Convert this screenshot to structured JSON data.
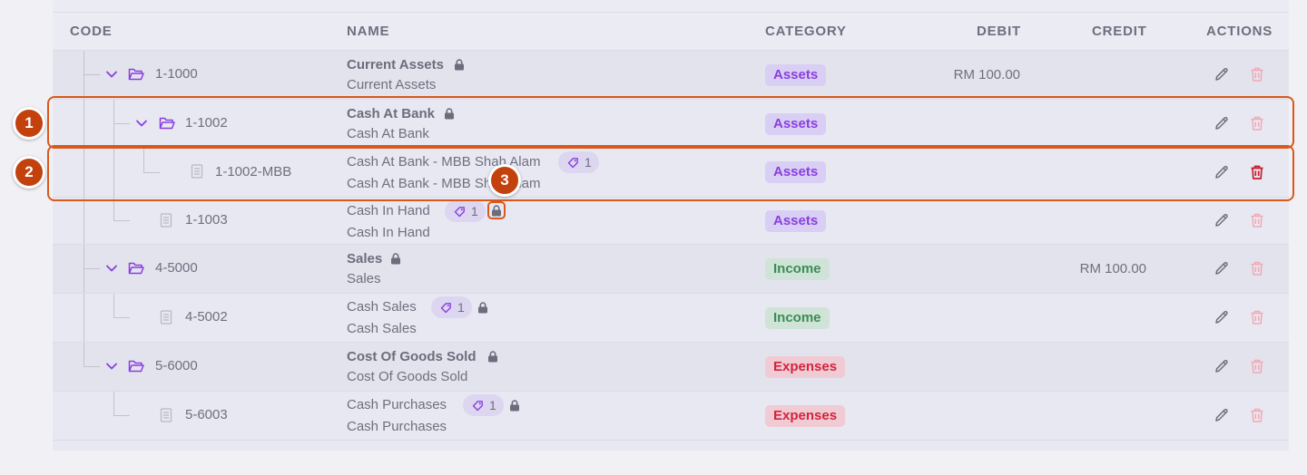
{
  "colors": {
    "accent_purple": "#8a3fe0",
    "income_green": "#3d8c56",
    "expense_red": "#d2243e",
    "highlight_orange": "#d9581a"
  },
  "header": {
    "code": "CODE",
    "name": "NAME",
    "category": "CATEGORY",
    "debit": "DEBIT",
    "credit": "CREDIT",
    "actions": "ACTIONS"
  },
  "rows": [
    {
      "code": "1-1000",
      "name": "Current Assets",
      "subname": "Current Assets",
      "category": "Assets",
      "debit": "RM 100.00",
      "credit": "",
      "locked": true,
      "tags": null,
      "type": "folder"
    },
    {
      "code": "1-1002",
      "name": "Cash At Bank",
      "subname": "Cash At Bank",
      "category": "Assets",
      "debit": "",
      "credit": "",
      "locked": true,
      "tags": null,
      "type": "folder"
    },
    {
      "code": "1-1002-MBB",
      "name": "Cash At Bank - MBB Shah Alam",
      "subname": "Cash At Bank - MBB Shah Alam",
      "category": "Assets",
      "debit": "",
      "credit": "",
      "locked": false,
      "tags": "1",
      "type": "account"
    },
    {
      "code": "1-1003",
      "name": "Cash In Hand",
      "subname": "Cash In Hand",
      "category": "Assets",
      "debit": "",
      "credit": "",
      "locked": true,
      "tags": "1",
      "type": "account"
    },
    {
      "code": "4-5000",
      "name": "Sales",
      "subname": "Sales",
      "category": "Income",
      "debit": "",
      "credit": "RM 100.00",
      "locked": true,
      "tags": null,
      "type": "folder"
    },
    {
      "code": "4-5002",
      "name": "Cash Sales",
      "subname": "Cash Sales",
      "category": "Income",
      "debit": "",
      "credit": "",
      "locked": true,
      "tags": "1",
      "type": "account"
    },
    {
      "code": "5-6000",
      "name": "Cost Of Goods Sold",
      "subname": "Cost Of Goods Sold",
      "category": "Expenses",
      "debit": "",
      "credit": "",
      "locked": true,
      "tags": null,
      "type": "folder"
    },
    {
      "code": "5-6003",
      "name": "Cash Purchases",
      "subname": "Cash Purchases",
      "category": "Expenses",
      "debit": "",
      "credit": "",
      "locked": true,
      "tags": "1",
      "type": "account"
    }
  ],
  "markers": [
    "1",
    "2",
    "3"
  ],
  "icons": {
    "expand": "chevron-down-icon",
    "folder": "folder-open-icon",
    "account": "document-icon",
    "lock": "lock-icon",
    "tag": "tag-icon",
    "edit": "pencil-icon",
    "delete": "trash-icon"
  }
}
